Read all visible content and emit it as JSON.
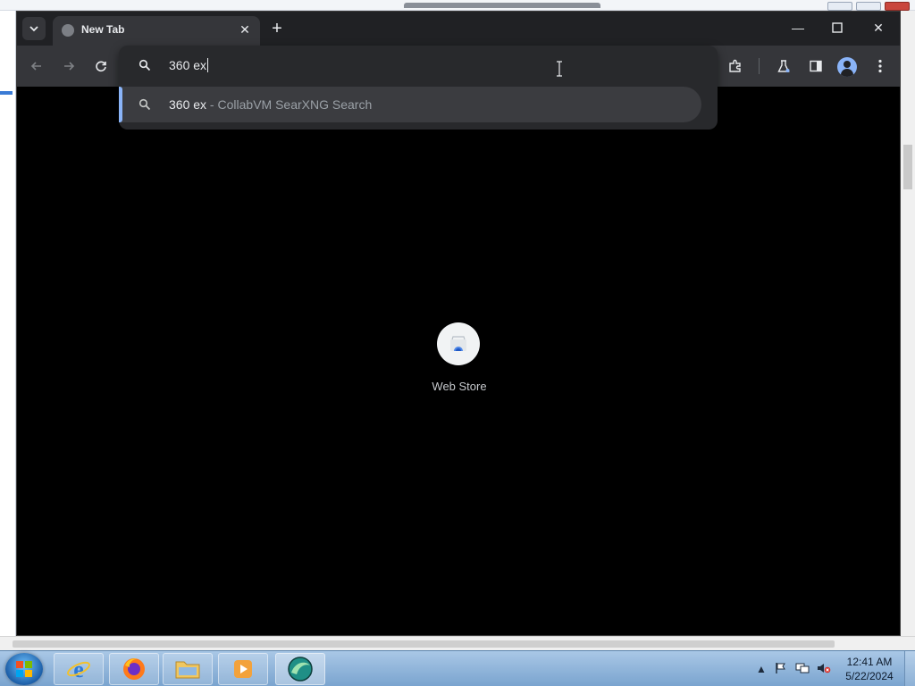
{
  "browser": {
    "tab": {
      "title": "New Tab"
    },
    "omnibox": {
      "value": "360 ex",
      "suggestion": {
        "query": "360 ex",
        "separator": " - ",
        "engine": "CollabVM SearXNG Search"
      }
    },
    "accent_color": "#8ab4f8"
  },
  "new_tab_page": {
    "shortcuts": [
      {
        "label": "Web Store",
        "icon": "chrome-web-store-icon"
      }
    ]
  },
  "taskbar": {
    "pinned": [
      {
        "name": "internet-explorer",
        "icon": "internet-explorer-icon"
      },
      {
        "name": "firefox",
        "icon": "firefox-icon"
      },
      {
        "name": "file-explorer",
        "icon": "folder-icon"
      },
      {
        "name": "media-player",
        "icon": "media-player-icon"
      },
      {
        "name": "browser",
        "icon": "browser-icon"
      }
    ],
    "clock": {
      "time": "12:41 AM",
      "date": "5/22/2024"
    }
  }
}
